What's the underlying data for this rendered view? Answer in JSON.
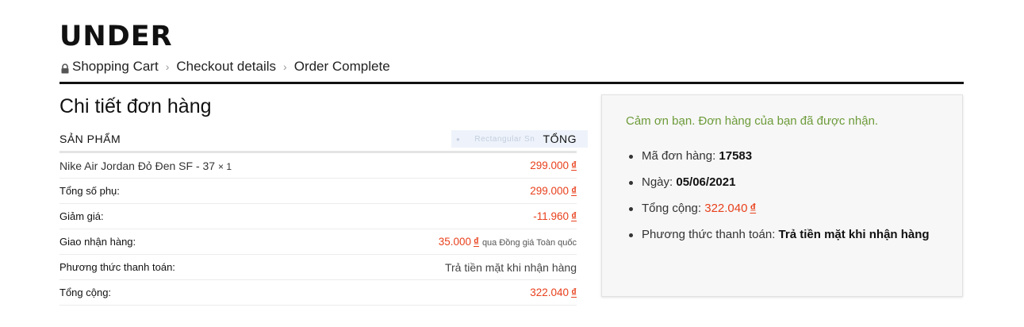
{
  "brand": {
    "logo": "UNDER"
  },
  "breadcrumb": {
    "steps": [
      "Shopping Cart",
      "Checkout details",
      "Order Complete"
    ],
    "separator": "›"
  },
  "order_details": {
    "title": "Chi tiết đơn hàng",
    "columns": {
      "product": "SẢN PHẨM",
      "total": "TỔNG"
    },
    "snip_overlay_text": "Rectangular Sn",
    "item": {
      "name": "Nike Air Jordan Đỏ Đen SF - 37",
      "qty": "× 1",
      "amount": "299.000",
      "currency": "₫"
    },
    "subtotal": {
      "label": "Tổng số phụ:",
      "amount": "299.000",
      "currency": "₫"
    },
    "discount": {
      "label": "Giảm giá:",
      "amount": "-11.960",
      "currency": "₫"
    },
    "shipping": {
      "label": "Giao nhận hàng:",
      "amount": "35.000",
      "currency": "₫",
      "note": "qua Đồng giá Toàn quốc"
    },
    "payment": {
      "label": "Phương thức thanh toán:",
      "value": "Trả tiền mặt khi nhận hàng"
    },
    "total": {
      "label": "Tổng cộng:",
      "amount": "322.040",
      "currency": "₫"
    }
  },
  "summary": {
    "thanks": "Cảm ơn bạn. Đơn hàng của bạn đã được nhận.",
    "order_no_label": "Mã đơn hàng:",
    "order_no": "17583",
    "date_label": "Ngày:",
    "date": "05/06/2021",
    "total_label": "Tổng cộng:",
    "total_amount": "322.040",
    "currency": "₫",
    "payment_label": "Phương thức thanh toán:",
    "payment_value": "Trả tiền mặt khi nhận hàng"
  },
  "colors": {
    "accent_price": "#e8401c",
    "thanks_green": "#6d9b3a"
  },
  "icons": {
    "lock": "lock-icon"
  }
}
